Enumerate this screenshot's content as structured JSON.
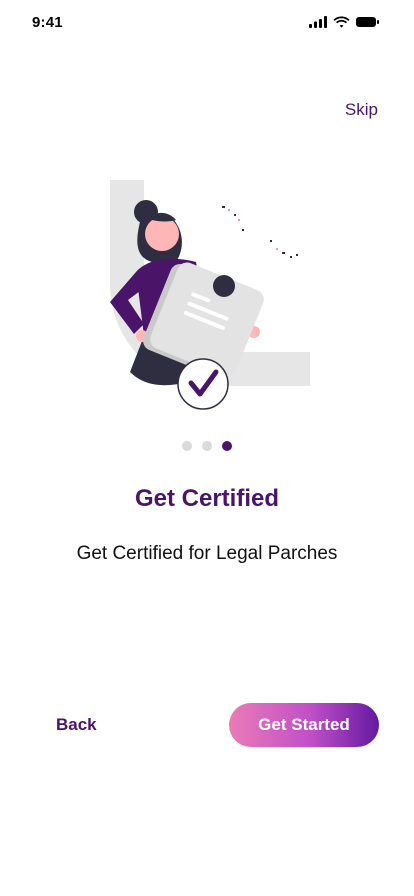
{
  "status_bar": {
    "time": "9:41"
  },
  "header": {
    "skip_label": "Skip"
  },
  "onboarding": {
    "pager": {
      "total": 3,
      "active_index": 2
    },
    "title": "Get Certified",
    "subtitle": "Get Certified for Legal Parches"
  },
  "footer": {
    "back_label": "Back",
    "primary_label": "Get Started"
  },
  "colors": {
    "brand": "#4a1468",
    "dot_inactive": "#d9d9d9",
    "gradient_start": "#ea7bb6",
    "gradient_end": "#6419a0"
  }
}
